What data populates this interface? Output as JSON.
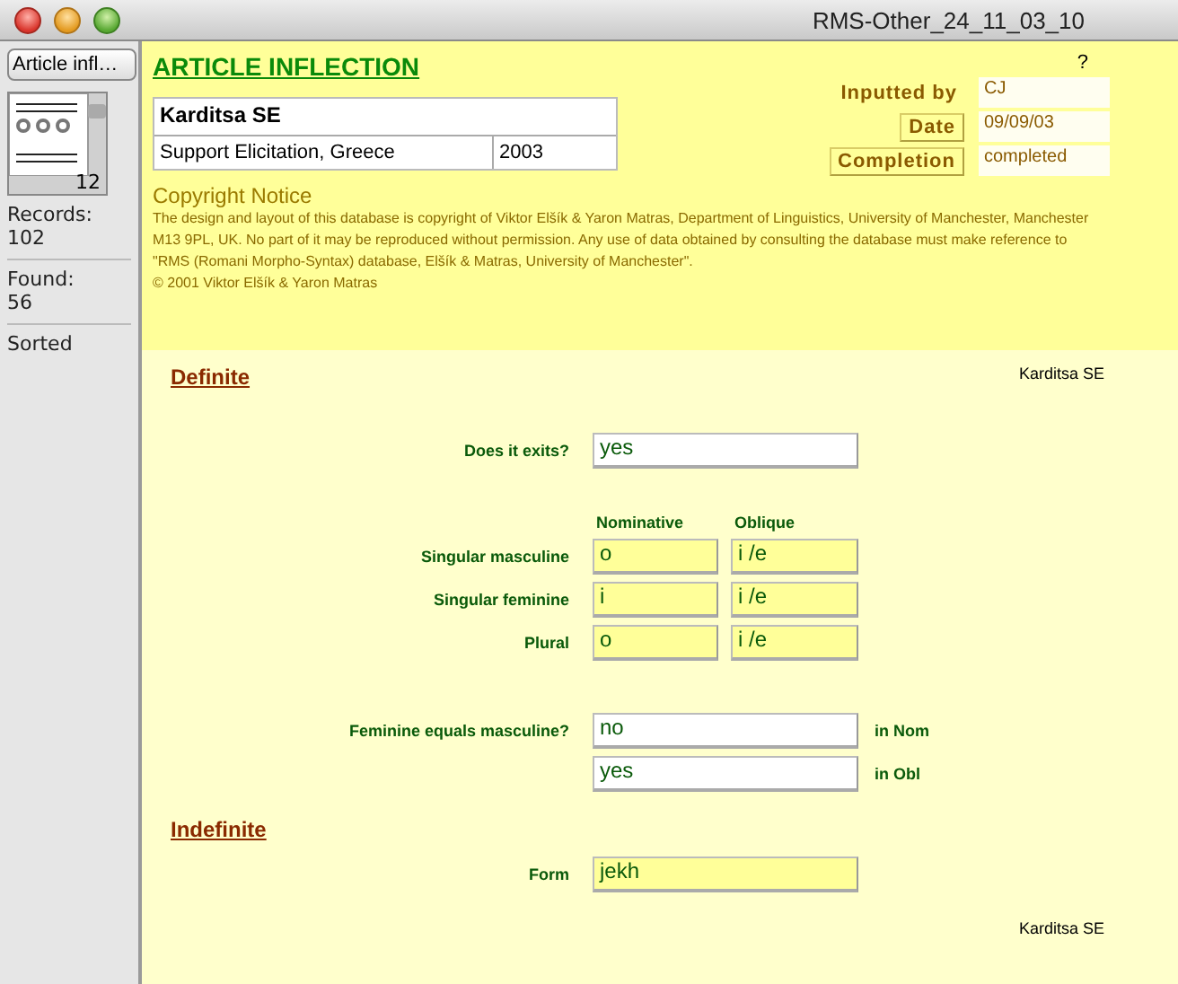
{
  "window": {
    "title": "RMS-Other_24_11_03_10"
  },
  "sidebar": {
    "layout_menu": "Article infl…",
    "record_number": "12",
    "records_label": "Records:",
    "records": "102",
    "found_label": "Found:",
    "found": "56",
    "sort_status": "Sorted"
  },
  "header": {
    "title": "ARTICLE INFLECTION",
    "help": "?",
    "location": "Karditsa SE",
    "source": "Support Elicitation, Greece",
    "year": "2003",
    "meta": [
      {
        "label": "Inputted by",
        "kind": "plain",
        "value": "CJ"
      },
      {
        "label": "Date",
        "kind": "button",
        "value": "09/09/03"
      },
      {
        "label": "Completion",
        "kind": "button",
        "value": "completed"
      }
    ],
    "copyright": {
      "heading": "Copyright Notice",
      "text": "The design and layout of this database is copyright of Viktor Elšík & Yaron Matras, Department of Linguistics, University of Manchester, Manchester M13 9PL, UK. No part of it may be reproduced without permission. Any use of data obtained by consulting the database must make reference to \"RMS (Romani Morpho-Syntax) database, Elšík & Matras, University of Manchester\".",
      "credit": "© 2001 Viktor Elšík & Yaron Matras"
    }
  },
  "definite": {
    "heading": "Definite",
    "location_tag": "Karditsa SE",
    "exists": {
      "label": "Does it exits?",
      "value": "yes"
    },
    "columns": [
      "Nominative",
      "Oblique"
    ],
    "rows": [
      {
        "label": "Singular masculine",
        "values": [
          "o",
          "i /e"
        ]
      },
      {
        "label": "Singular feminine",
        "values": [
          "i",
          "i /e"
        ]
      },
      {
        "label": "Plural",
        "values": [
          "o",
          "i /e"
        ]
      }
    ],
    "fem_eq_masc": {
      "label": "Feminine equals masculine?",
      "rows": [
        {
          "value": "no",
          "note": "in Nom"
        },
        {
          "value": "yes",
          "note": "in Obl"
        }
      ]
    }
  },
  "indefinite": {
    "heading": "Indefinite",
    "form": {
      "label": "Form",
      "value": "jekh"
    }
  },
  "footer": {
    "location_tag": "Karditsa SE"
  }
}
